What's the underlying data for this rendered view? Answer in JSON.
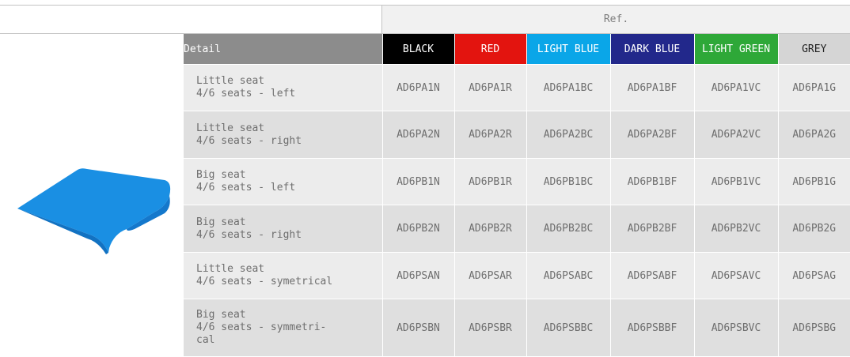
{
  "header": {
    "ref_label": "Ref."
  },
  "columns": [
    {
      "key": "black",
      "label": "BLACK",
      "bg": "#000000",
      "fg": "#ffffff"
    },
    {
      "key": "red",
      "label": "RED",
      "bg": "#e3140f",
      "fg": "#ffffff"
    },
    {
      "key": "light_blue",
      "label": "LIGHT BLUE",
      "bg": "#0aa6e8",
      "fg": "#ffffff"
    },
    {
      "key": "dark_blue",
      "label": "DARK BLUE",
      "bg": "#22288b",
      "fg": "#ffffff"
    },
    {
      "key": "light_green",
      "label": "LIGHT GREEN",
      "bg": "#2ea838",
      "fg": "#ffffff"
    },
    {
      "key": "grey",
      "label": "GREY",
      "bg": "#d5d5d5",
      "fg": "#222222"
    }
  ],
  "detail_header": "Detail",
  "rows": [
    {
      "detail": [
        "Little seat",
        "4/6 seats - left"
      ],
      "refs": [
        "AD6PA1N",
        "AD6PA1R",
        "AD6PA1BC",
        "AD6PA1BF",
        "AD6PA1VC",
        "AD6PA1G"
      ]
    },
    {
      "detail": [
        "Little seat",
        "4/6 seats - right"
      ],
      "refs": [
        "AD6PA2N",
        "AD6PA2R",
        "AD6PA2BC",
        "AD6PA2BF",
        "AD6PA2VC",
        "AD6PA2G"
      ]
    },
    {
      "detail": [
        "Big seat",
        "4/6 seats - left"
      ],
      "refs": [
        "AD6PB1N",
        "AD6PB1R",
        "AD6PB1BC",
        "AD6PB1BF",
        "AD6PB1VC",
        "AD6PB1G"
      ]
    },
    {
      "detail": [
        "Big seat",
        "4/6 seats - right"
      ],
      "refs": [
        "AD6PB2N",
        "AD6PB2R",
        "AD6PB2BC",
        "AD6PB2BF",
        "AD6PB2VC",
        "AD6PB2G"
      ]
    },
    {
      "detail": [
        "Little seat",
        "4/6 seats - symetrical"
      ],
      "refs": [
        "AD6PSAN",
        "AD6PSAR",
        "AD6PSABC",
        "AD6PSABF",
        "AD6PSAVC",
        "AD6PSAG"
      ]
    },
    {
      "detail": [
        "Big seat",
        "4/6 seats - symmetri-",
        "cal"
      ],
      "refs": [
        "AD6PSBN",
        "AD6PSBR",
        "AD6PSBBC",
        "AD6PSBBF",
        "AD6PSBVC",
        "AD6PSBG"
      ]
    }
  ],
  "product_image": {
    "icon": "blue-seat-cushion-icon",
    "color": "#1a8fe3"
  }
}
